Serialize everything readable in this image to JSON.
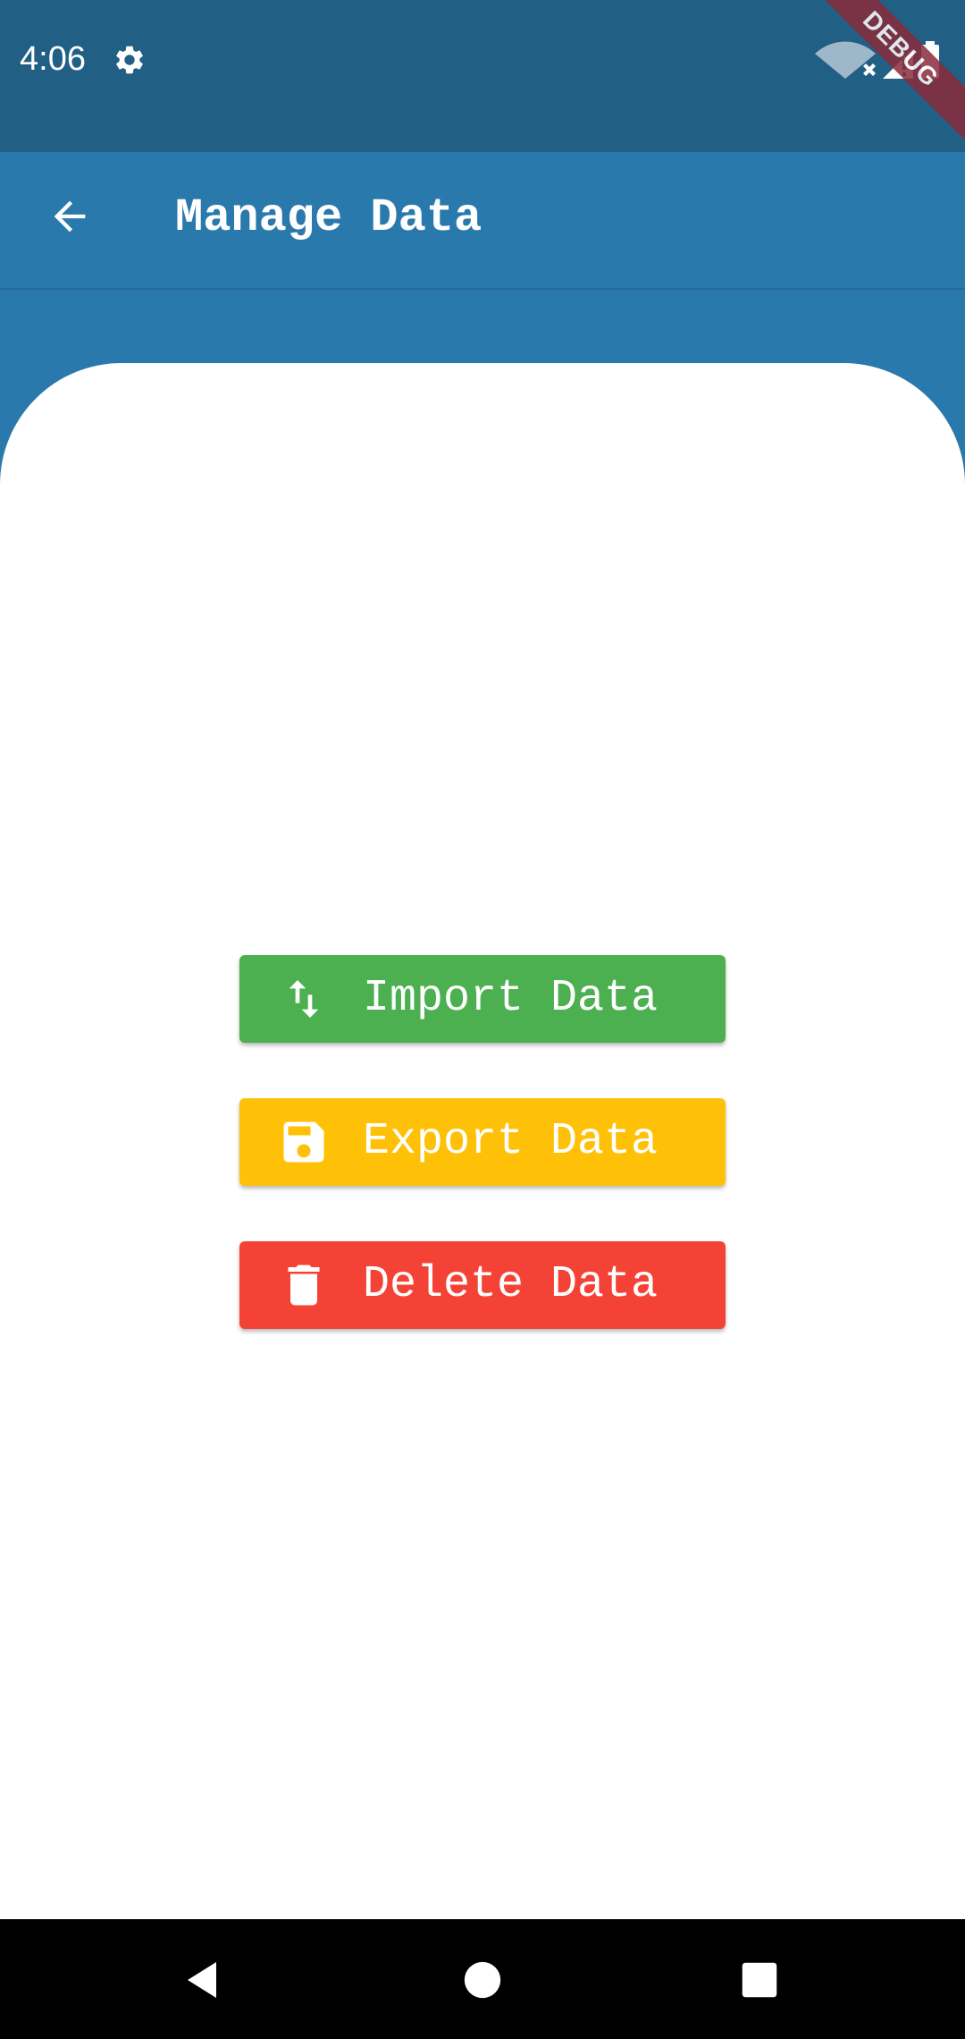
{
  "status_bar": {
    "time": "4:06",
    "settings_icon": "gear-icon",
    "wifi_icon": "wifi-off-icon",
    "signal_icon": "signal-alert-icon",
    "battery_icon": "battery-icon"
  },
  "debug_banner": {
    "label": "DEBUG"
  },
  "app_bar": {
    "back_icon": "arrow-left-icon",
    "title": "Manage Data"
  },
  "actions": [
    {
      "label": "Import Data",
      "icon": "swap-vertical-icon",
      "color": "#4caf50"
    },
    {
      "label": "Export Data",
      "icon": "floppy-disk-icon",
      "color": "#ffc107"
    },
    {
      "label": "Delete Data",
      "icon": "trash-icon",
      "color": "#f44336"
    }
  ],
  "nav_bar": {
    "back_icon": "nav-back-icon",
    "home_icon": "nav-home-icon",
    "recents_icon": "nav-recents-icon"
  },
  "colors": {
    "app_bar": "#2a79ac",
    "status_bar": "#215f85",
    "card": "#ffffff",
    "nav_bar": "#000000"
  }
}
